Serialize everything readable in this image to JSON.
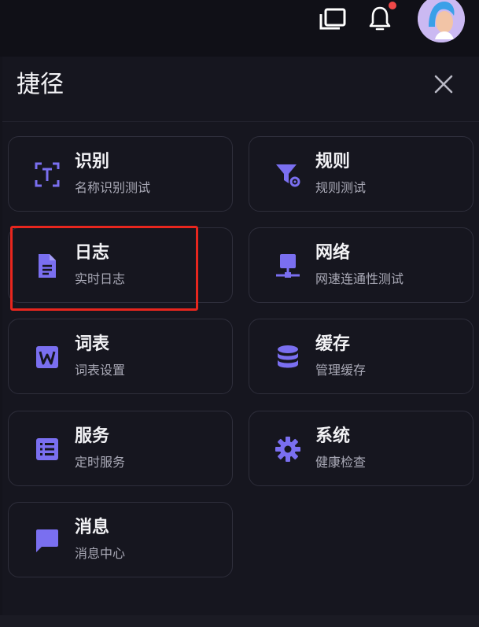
{
  "colors": {
    "accent": "#7a6ff0",
    "badge": "#f04848",
    "highlight": "#e8261e"
  },
  "topbar": {
    "icons": [
      "windows-icon",
      "bell-icon",
      "avatar"
    ],
    "has_notification": true
  },
  "panel": {
    "title": "捷径",
    "close_icon": "close-icon"
  },
  "shortcuts": [
    {
      "title": "识别",
      "subtitle": "名称识别测试",
      "icon": "text-recognition-icon"
    },
    {
      "title": "规则",
      "subtitle": "规则测试",
      "icon": "filter-settings-icon"
    },
    {
      "title": "日志",
      "subtitle": "实时日志",
      "icon": "document-icon"
    },
    {
      "title": "网络",
      "subtitle": "网速连通性测试",
      "icon": "network-icon"
    },
    {
      "title": "词表",
      "subtitle": "词表设置",
      "icon": "word-icon"
    },
    {
      "title": "缓存",
      "subtitle": "管理缓存",
      "icon": "database-icon"
    },
    {
      "title": "服务",
      "subtitle": "定时服务",
      "icon": "list-icon"
    },
    {
      "title": "系统",
      "subtitle": "健康检查",
      "icon": "gear-icon"
    },
    {
      "title": "消息",
      "subtitle": "消息中心",
      "icon": "message-icon"
    }
  ]
}
